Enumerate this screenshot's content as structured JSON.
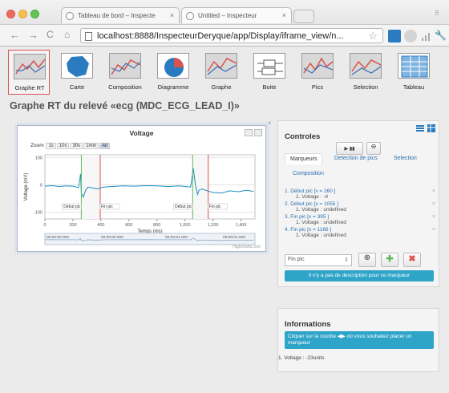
{
  "browser": {
    "tabs": [
      {
        "title": "Tableau de bord – Inspecte"
      },
      {
        "title": "Untitled – Inspecteur"
      }
    ],
    "url": "localhost:8888/InspecteurDeryque/app/Display/iframe_view/n..."
  },
  "tools": [
    {
      "label": "Graphe RT",
      "active": true
    },
    {
      "label": "Carte"
    },
    {
      "label": "Composition"
    },
    {
      "label": "Diagramme"
    },
    {
      "label": "Graphe"
    },
    {
      "label": "Boite"
    },
    {
      "label": "Pics"
    },
    {
      "label": "Selection"
    },
    {
      "label": "Tableau"
    }
  ],
  "page_title": "Graphe RT du relevé «ecg (MDC_ECG_LEAD_I)»",
  "chart": {
    "zoom_label": "Zoom",
    "zoom_options": [
      "1s",
      "10s",
      "30s",
      "1min",
      "All"
    ],
    "zoom_selected": "All",
    "credit": "Highcharts.com"
  },
  "chart_data": {
    "type": "line",
    "title": "Voltage",
    "xlabel": "Temps (ms)",
    "ylabel": "Voltage (mV)",
    "xlim": [
      0,
      1500
    ],
    "ylim": [
      -125,
      110
    ],
    "x_ticks": [
      "0",
      "200",
      "400",
      "600",
      "800",
      "1,000",
      "1,200",
      "1,400"
    ],
    "y_ticks": [
      "100",
      "0",
      "-100"
    ],
    "navigator_labels": [
      "00:00:00.000",
      "00:00:00.500",
      "00:00:01.000",
      "00:00:01.500"
    ],
    "series": [
      {
        "x": [
          0,
          50,
          100,
          150,
          200,
          240,
          255,
          260,
          275,
          290,
          310,
          340,
          380,
          400,
          420,
          480,
          560,
          640,
          720,
          800,
          880,
          960,
          1040,
          1060,
          1075,
          1090,
          1100,
          1120,
          1150,
          1180,
          1200,
          1260,
          1320,
          1380,
          1440,
          1490
        ],
        "y": [
          -5,
          -3,
          -6,
          -4,
          -5,
          -10,
          40,
          -30,
          -45,
          -20,
          -8,
          -12,
          -15,
          -10,
          -8,
          -6,
          -4,
          -5,
          -3,
          -4,
          -6,
          -4,
          -8,
          60,
          -2,
          -35,
          -20,
          -15,
          -20,
          -25,
          -28,
          -30,
          -22,
          -25,
          -20,
          -24
        ]
      }
    ],
    "markers": [
      {
        "type": "begin",
        "x": 260,
        "label": "Début pic"
      },
      {
        "type": "end",
        "x": 395,
        "label": "Fin pic"
      },
      {
        "type": "begin",
        "x": 1055,
        "label": "Début pic"
      },
      {
        "type": "end",
        "x": 1166,
        "label": "Fin pic"
      }
    ]
  },
  "controls": {
    "title": "Controles",
    "play_label": "▶ ▮▮",
    "tabs": [
      "Marqueurs",
      "Detection de pics",
      "Selection",
      "Composition"
    ],
    "markers": [
      {
        "title": "Début pic [x = 260 ]",
        "sub": "Voltage : -4"
      },
      {
        "title": "Début pic [x = 1055 ]",
        "sub": "Voltage : undefined"
      },
      {
        "title": "Fin pic [x = 395 ]",
        "sub": "Voltage : undefined"
      },
      {
        "title": "Fin pic [x = 1166 ]",
        "sub": "Voltage : undefined"
      }
    ],
    "select_value": "Fin pic",
    "no_desc": "Il n'y a pas de description pour ce marqueur"
  },
  "info": {
    "title": "Informations",
    "hint": "Cliquer sur la courbe ◀▶ où vous souhaitez placer un marqueur",
    "value": "Voltage : -23units"
  },
  "colors": {
    "marker_begin": "#5cb85c",
    "marker_end": "#d9534f",
    "series": "#1f8fbf",
    "info": "#2fa4c9"
  }
}
